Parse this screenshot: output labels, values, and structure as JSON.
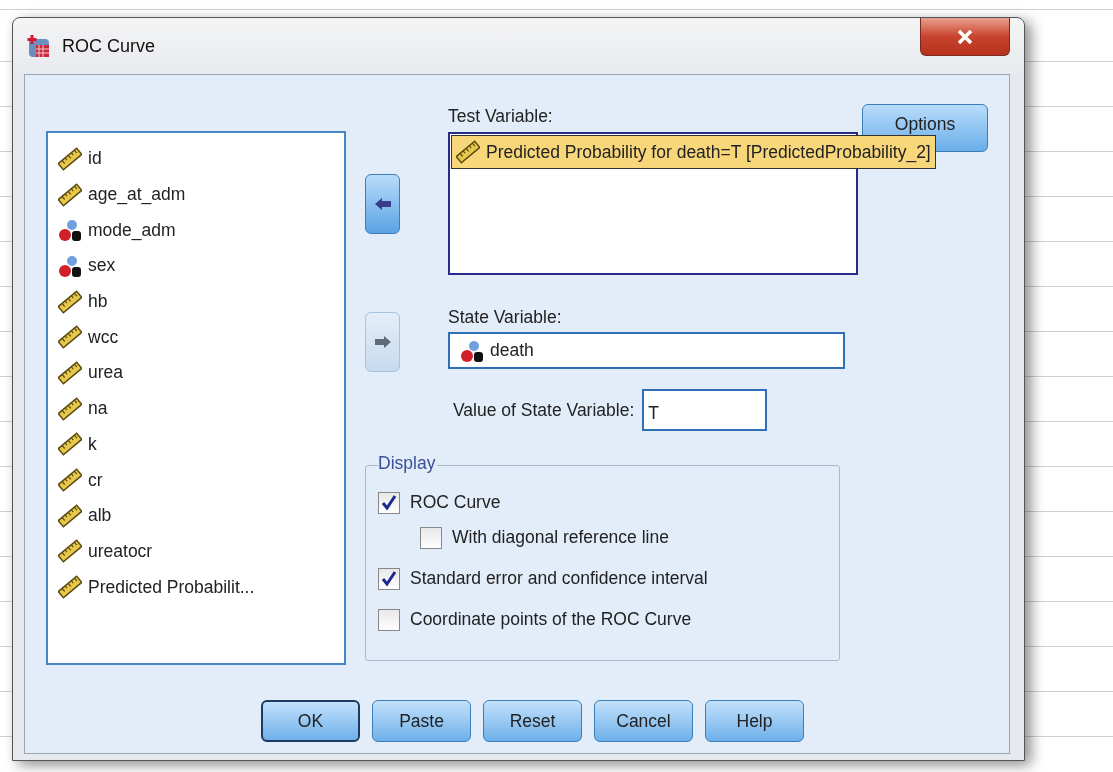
{
  "window": {
    "title": "ROC Curve"
  },
  "variables": [
    {
      "name": "id",
      "kind": "scale"
    },
    {
      "name": "age_at_adm",
      "kind": "scale"
    },
    {
      "name": "mode_adm",
      "kind": "nominal"
    },
    {
      "name": "sex",
      "kind": "nominal"
    },
    {
      "name": "hb",
      "kind": "scale"
    },
    {
      "name": "wcc",
      "kind": "scale"
    },
    {
      "name": "urea",
      "kind": "scale"
    },
    {
      "name": "na",
      "kind": "scale"
    },
    {
      "name": "k",
      "kind": "scale"
    },
    {
      "name": "cr",
      "kind": "scale"
    },
    {
      "name": "alb",
      "kind": "scale"
    },
    {
      "name": "ureatocr",
      "kind": "scale"
    },
    {
      "name": "Predicted Probabilit...",
      "kind": "scale"
    }
  ],
  "move_buttons": [
    {
      "disabled": false
    },
    {
      "disabled": true
    }
  ],
  "test_variable": {
    "label": "Test Variable:",
    "tooltip": {
      "text": "Predicted Probability for death=T [PredictedProbability_2]",
      "kind": "scale"
    }
  },
  "options_button": "Options",
  "state_variable": {
    "label": "State Variable:",
    "value": "death",
    "kind": "nominal"
  },
  "value_of_state": {
    "label": "Value of State Variable:",
    "value": "T"
  },
  "display": {
    "title": "Display",
    "options": [
      {
        "label": "ROC Curve",
        "checked": true,
        "children": [
          {
            "label": "With diagonal reference line",
            "checked": false
          }
        ]
      },
      {
        "label": "Standard error and confidence interval",
        "checked": true
      },
      {
        "label": "Coordinate points of the ROC Curve",
        "checked": false
      }
    ]
  },
  "buttons": [
    {
      "label": "OK",
      "default": true
    },
    {
      "label": "Paste",
      "default": false
    },
    {
      "label": "Reset",
      "default": false
    },
    {
      "label": "Cancel",
      "default": false
    },
    {
      "label": "Help",
      "default": false
    }
  ]
}
